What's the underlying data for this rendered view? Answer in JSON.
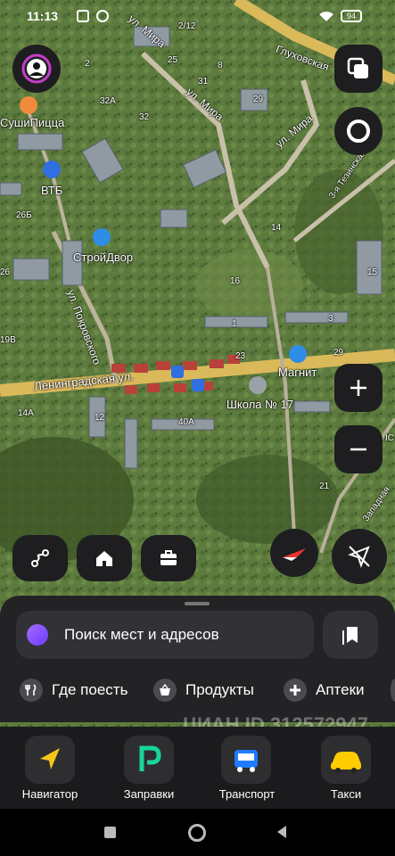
{
  "status_bar": {
    "time": "11:13",
    "battery": "94"
  },
  "map": {
    "labels": {
      "glukhovskaya": "Глуховская",
      "mira1": "ул. Мира",
      "mira2": "ул. Мира",
      "mira3": "ул. Мира",
      "sushi": "СушиПицца",
      "vtb": "ВТБ",
      "stroydvor": "СтройДвор",
      "pokrovskaya": "ул. Покровского",
      "leningradskaya": "Ленинградская ул.",
      "magnit": "Магнит",
      "school": "Школа № 17",
      "tezhinskaya": "3-я Тезинская",
      "zapadnaya": "Западная",
      "n2_12": "2/12",
      "n2": "2",
      "n25": "25",
      "n8": "8",
      "n31": "31",
      "n29": "29",
      "n32a": "32А",
      "n32": "32",
      "n26b": "26Б",
      "n26": "26",
      "n16": "16",
      "n14": "14",
      "n1": "1",
      "n3": "3",
      "n29b": "29",
      "n23": "23",
      "n12": "12",
      "n40a": "40А",
      "n21": "21",
      "n15": "15",
      "n19b": "19В",
      "n14a": "14А",
      "ic": "IC"
    }
  },
  "search": {
    "placeholder": "Поиск мест и адресов"
  },
  "chips": [
    {
      "label": "Где поесть",
      "icon": "fork-knife-icon"
    },
    {
      "label": "Продукты",
      "icon": "basket-icon"
    },
    {
      "label": "Аптеки",
      "icon": "pharmacy-cross-icon"
    }
  ],
  "dock": [
    {
      "label": "Навигатор",
      "icon": "navigator-arrow-icon",
      "color": "#f5c518"
    },
    {
      "label": "Заправки",
      "icon": "fuel-p-icon",
      "color": "#16d69a"
    },
    {
      "label": "Транспорт",
      "icon": "bus-icon",
      "color": "#1f7bff"
    },
    {
      "label": "Такси",
      "icon": "taxi-car-icon",
      "color": "#ffcc00"
    }
  ],
  "watermark": "ЦИАН  ID 312572947",
  "colors": {
    "map_green": "#5c7a3c",
    "road": "#e8c75a",
    "panel": "#232326",
    "accent_search": "#7c4dff"
  }
}
